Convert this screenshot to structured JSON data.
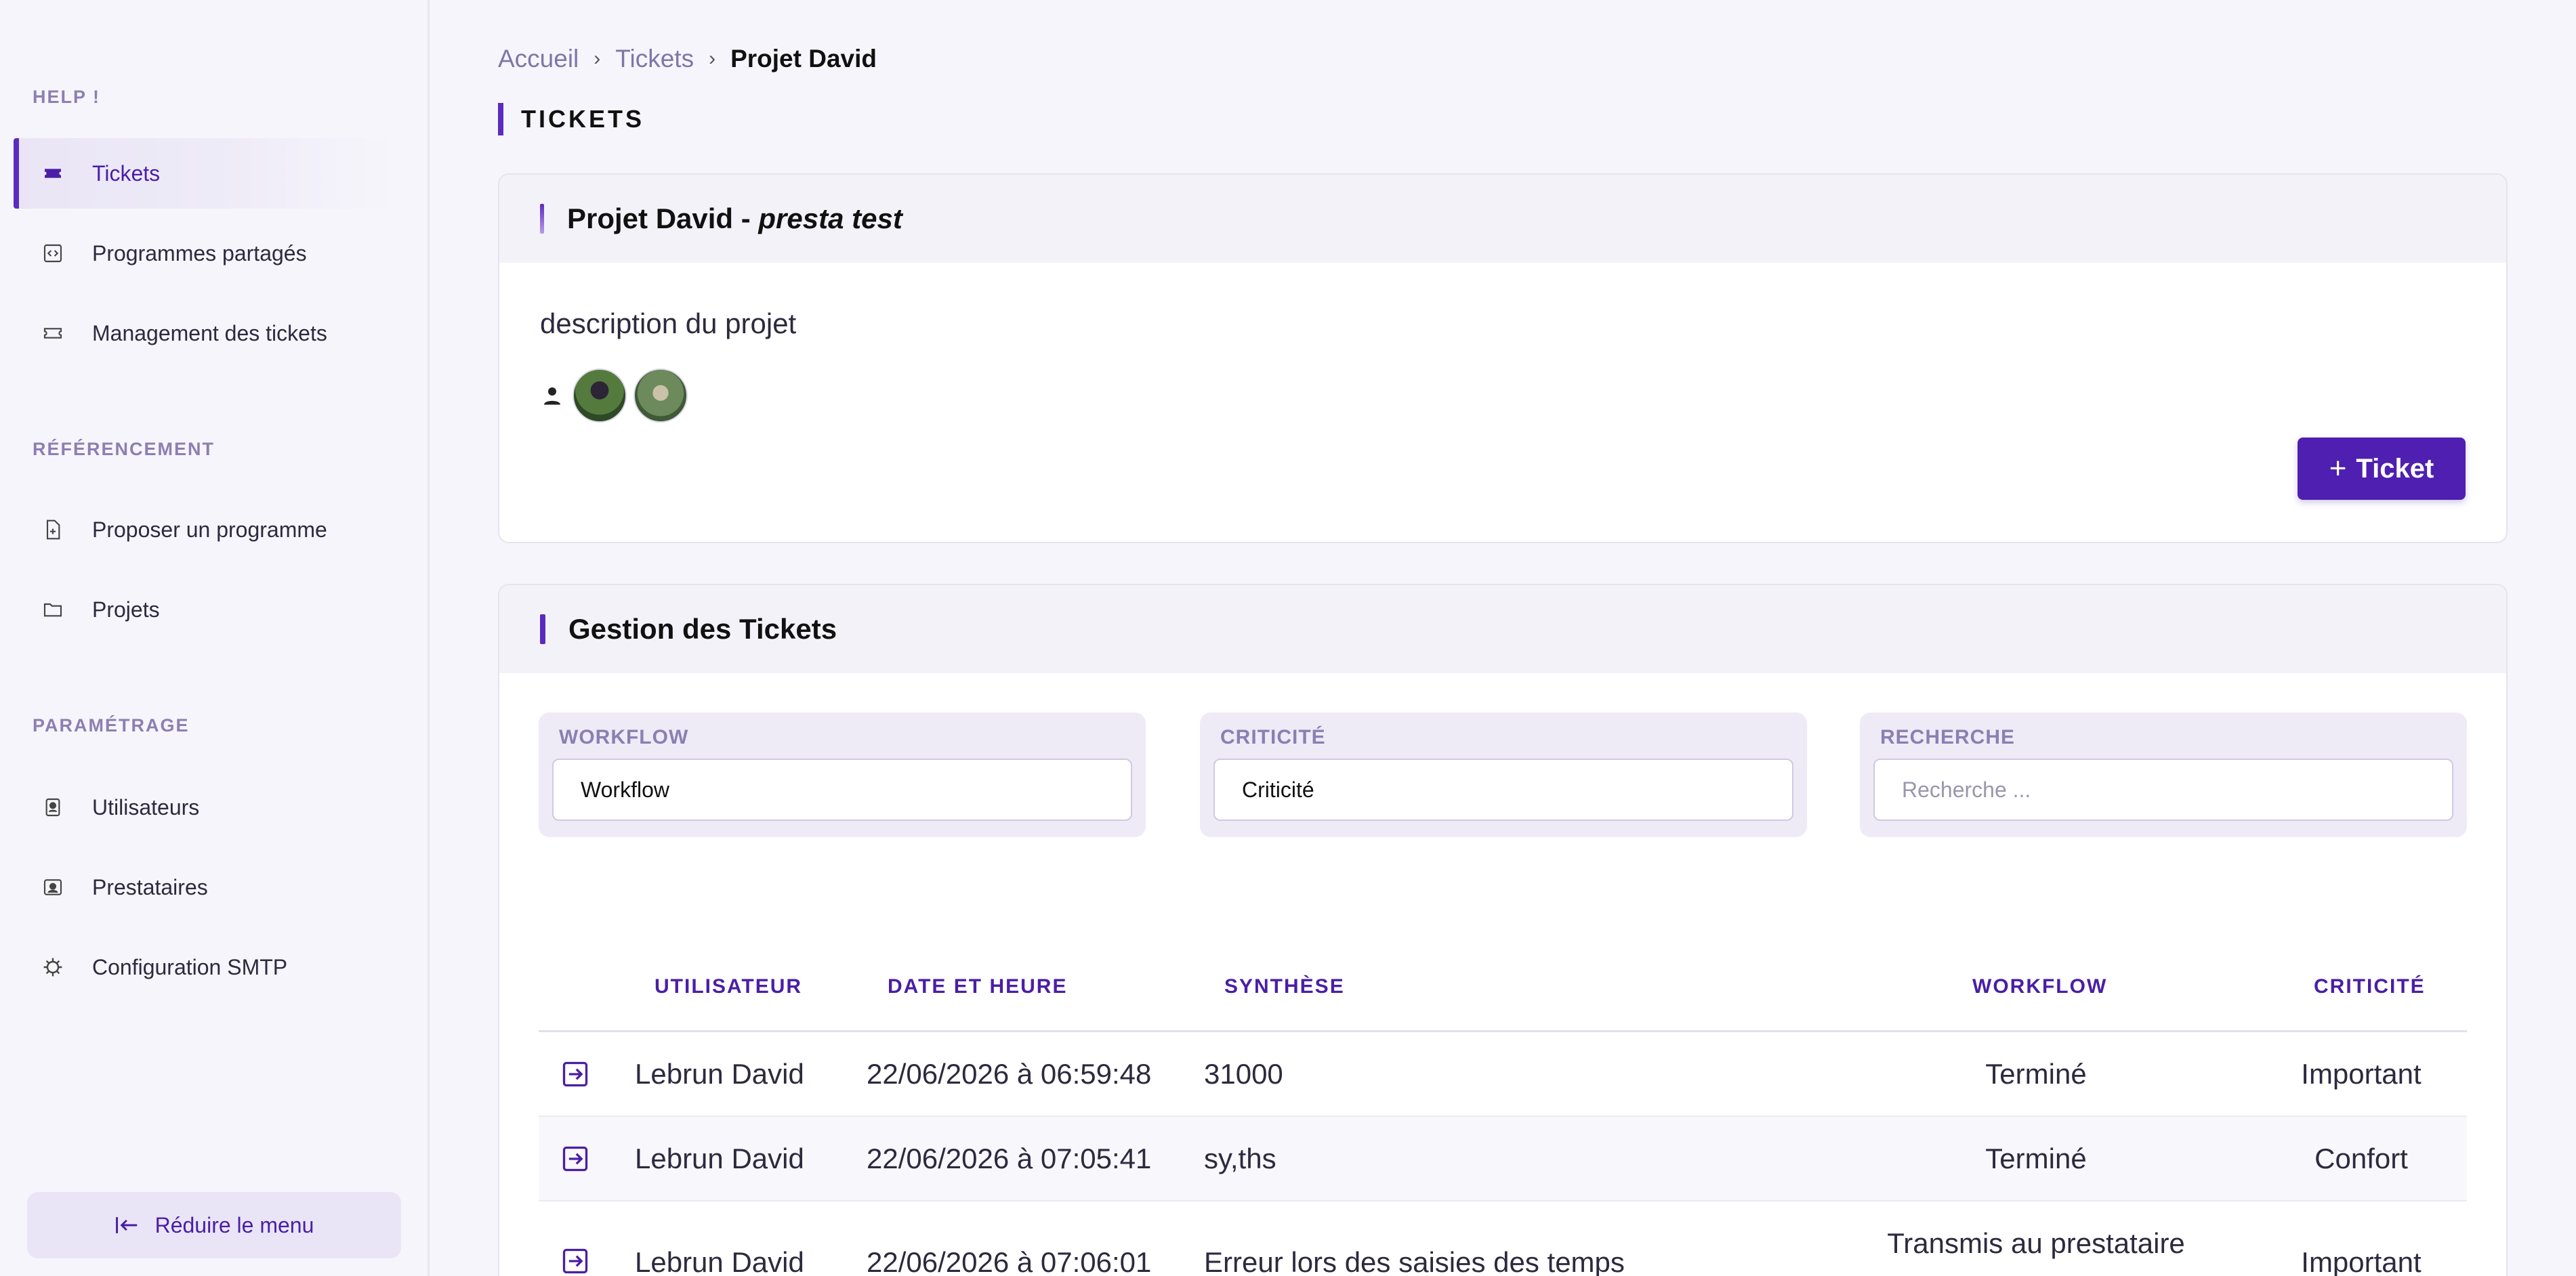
{
  "sidebar": {
    "sections": [
      {
        "title": "HELP !"
      },
      {
        "title": "RÉFÉRENCEMENT"
      },
      {
        "title": "PARAMÉTRAGE"
      }
    ],
    "items": [
      {
        "label": "Tickets",
        "icon": "ticket-icon"
      },
      {
        "label": "Programmes partagés",
        "icon": "code-icon"
      },
      {
        "label": "Management des tickets",
        "icon": "ticket-outline-icon"
      },
      {
        "label": "Proposer un programme",
        "icon": "file-plus-icon"
      },
      {
        "label": "Projets",
        "icon": "folder-icon"
      },
      {
        "label": "Utilisateurs",
        "icon": "user-badge-icon"
      },
      {
        "label": "Prestataires",
        "icon": "contact-card-icon"
      },
      {
        "label": "Configuration SMTP",
        "icon": "gear-icon"
      }
    ],
    "collapse_label": "Réduire le menu"
  },
  "breadcrumb": {
    "items": [
      "Accueil",
      "Tickets",
      "Projet David"
    ]
  },
  "page_title": "TICKETS",
  "project": {
    "name": "Projet David - ",
    "provider": "presta test",
    "description": "description du projet",
    "add_ticket_label": "Ticket"
  },
  "tickets_card": {
    "title": "Gestion des Tickets",
    "filters": [
      {
        "label": "WORKFLOW",
        "value": "Workflow",
        "placeholder": ""
      },
      {
        "label": "CRITICITÉ",
        "value": "Criticité",
        "placeholder": ""
      },
      {
        "label": "RECHERCHE",
        "value": "",
        "placeholder": "Recherche ..."
      }
    ],
    "columns": [
      "UTILISATEUR",
      "DATE ET HEURE",
      "SYNTHÈSE",
      "WORKFLOW",
      "CRITICITÉ"
    ],
    "rows": [
      {
        "user": "Lebrun David",
        "datetime": "22/06/2026 à 06:59:48",
        "summary": "31000",
        "workflow": "Terminé",
        "criticity": "Important"
      },
      {
        "user": "Lebrun David",
        "datetime": "22/06/2026 à 07:05:41",
        "summary": "sy,ths",
        "workflow": "Terminé",
        "criticity": "Confort"
      },
      {
        "user": "Lebrun David",
        "datetime": "22/06/2026 à 07:06:01",
        "summary": "Erreur lors des saisies des temps",
        "workflow": "Transmis au prestataire",
        "criticity": "Important"
      }
    ]
  },
  "colors": {
    "accent": "#4e1fb0",
    "accent_light": "#eeebf7",
    "muted_label": "#8c7fb2"
  }
}
